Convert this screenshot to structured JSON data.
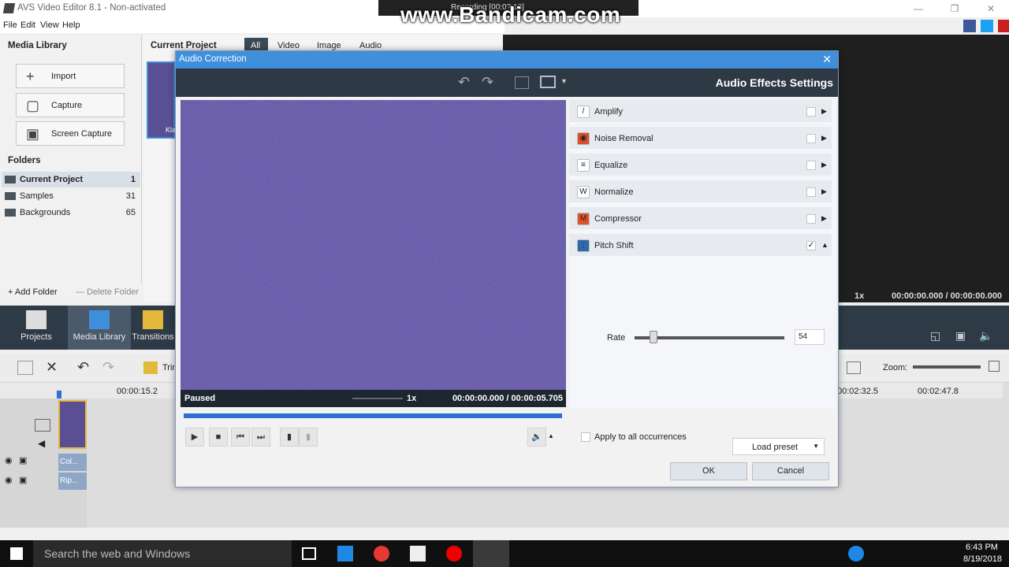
{
  "app": {
    "title": "AVS Video Editor 8.1 - Non-activated",
    "menu": [
      "File",
      "Edit",
      "View",
      "Help"
    ]
  },
  "watermark": {
    "recording": "Recording [00:0?:13]",
    "brand": "www.Bandicam.com"
  },
  "left_panel": {
    "media_library_title": "Media Library",
    "buttons": [
      "Import",
      "Capture",
      "Screen Capture"
    ],
    "folders_title": "Folders",
    "folders": [
      {
        "name": "Current Project",
        "count": "1"
      },
      {
        "name": "Samples",
        "count": "31"
      },
      {
        "name": "Backgrounds",
        "count": "65"
      }
    ],
    "add_folder": "Add Folder",
    "delete_folder": "Delete Folder"
  },
  "center": {
    "title": "Current Project",
    "tabs": [
      "All",
      "Video",
      "Image",
      "Audio"
    ],
    "thumb_label": "Kla"
  },
  "right_preview": {
    "speed": "1x",
    "time": "00:00:00.000 / 00:00:00.000"
  },
  "nav": [
    "Projects",
    "Media Library",
    "Transitions"
  ],
  "timeline": {
    "trim_label": "Trim",
    "zoom_label": "Zoom:",
    "ticks": [
      "00:00:15.2",
      "00:02:32.5",
      "00:02:47.8"
    ],
    "clips": [
      "Col...",
      "Rip..."
    ]
  },
  "taskbar": {
    "search_placeholder": "Search the web and Windows",
    "time": "6:43 PM",
    "date": "8/19/2018"
  },
  "dialog": {
    "title": "Audio Correction",
    "header": "Audio Effects Settings",
    "player": {
      "status": "Paused",
      "speed": "1x",
      "time": "00:00:00.000 / 00:00:05.705",
      "progress": 0.0
    },
    "effects": [
      {
        "name": "Amplify",
        "checked": false,
        "expanded": false,
        "color": "#ffffff"
      },
      {
        "name": "Noise Removal",
        "checked": false,
        "expanded": false,
        "color": "#d94f2b"
      },
      {
        "name": "Equalize",
        "checked": false,
        "expanded": false,
        "color": "#ffffff"
      },
      {
        "name": "Normalize",
        "checked": false,
        "expanded": false,
        "color": "#ffffff"
      },
      {
        "name": "Compressor",
        "checked": false,
        "expanded": false,
        "color": "#e0522c"
      },
      {
        "name": "Pitch Shift",
        "checked": true,
        "expanded": true,
        "color": "#2f6aa8"
      }
    ],
    "rate": {
      "label": "Rate",
      "value": "54"
    },
    "load_preset": "Load preset",
    "apply_all": "Apply to all occurrences",
    "ok": "OK",
    "cancel": "Cancel"
  }
}
